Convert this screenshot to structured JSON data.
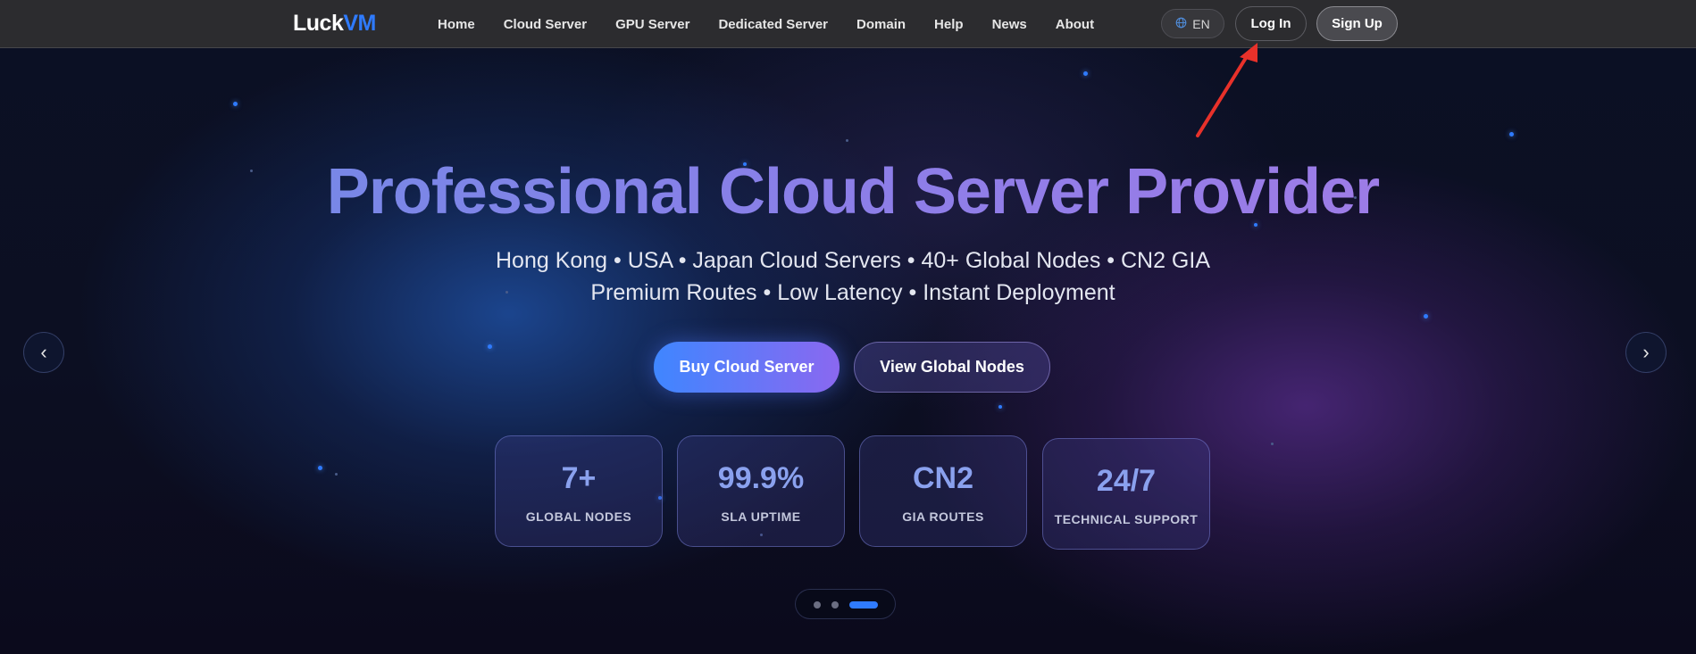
{
  "header": {
    "logo_main": "Luck",
    "logo_accent": "VM",
    "nav": [
      {
        "label": "Home"
      },
      {
        "label": "Cloud Server"
      },
      {
        "label": "GPU Server"
      },
      {
        "label": "Dedicated Server"
      },
      {
        "label": "Domain"
      },
      {
        "label": "Help"
      },
      {
        "label": "News"
      },
      {
        "label": "About"
      }
    ],
    "language": "EN",
    "language_icon": "globe-icon",
    "login_label": "Log In",
    "signup_label": "Sign Up"
  },
  "hero": {
    "title": "Professional Cloud Server Provider",
    "subtitle": "Hong Kong  •  USA  •  Japan Cloud Servers  •  40+ Global Nodes  •  CN2 GIA Premium Routes  •  Low Latency  •  Instant Deployment",
    "primary_cta": "Buy Cloud Server",
    "secondary_cta": "View Global Nodes",
    "stats": [
      {
        "value": "7+",
        "label": "GLOBAL NODES"
      },
      {
        "value": "99.9%",
        "label": "SLA UPTIME"
      },
      {
        "value": "CN2",
        "label": "GIA ROUTES"
      },
      {
        "value": "24/7",
        "label": "TECHNICAL SUPPORT"
      }
    ],
    "prev_arrow": "‹",
    "next_arrow": "›",
    "slide_count": 3,
    "active_slide": 3
  },
  "colors": {
    "accent_blue": "#2f7bff",
    "nav_bg": "#2c2c2f",
    "annotation_red": "#e8312a"
  }
}
